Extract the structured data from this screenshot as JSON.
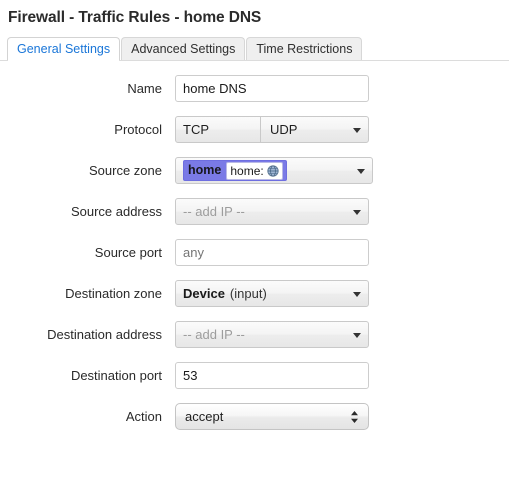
{
  "page": {
    "title": "Firewall - Traffic Rules - home DNS"
  },
  "tabs": [
    {
      "label": "General Settings",
      "active": true
    },
    {
      "label": "Advanced Settings",
      "active": false
    },
    {
      "label": "Time Restrictions",
      "active": false
    }
  ],
  "form": {
    "name": {
      "label": "Name",
      "value": "home DNS"
    },
    "protocol": {
      "label": "Protocol",
      "first": "TCP",
      "second": "UDP"
    },
    "source_zone": {
      "label": "Source zone",
      "token_key": "home",
      "token_chip_label": "home:",
      "token_chip_icon": "globe-icon"
    },
    "source_address": {
      "label": "Source address",
      "value": "-- add IP --"
    },
    "source_port": {
      "label": "Source port",
      "placeholder": "any",
      "value": ""
    },
    "destination_zone": {
      "label": "Destination zone",
      "value_strong": "Device",
      "value_soft": "(input)"
    },
    "destination_address": {
      "label": "Destination address",
      "value": "-- add IP --"
    },
    "destination_port": {
      "label": "Destination port",
      "value": "53"
    },
    "action": {
      "label": "Action",
      "value": "accept"
    }
  },
  "colors": {
    "accent_tab": "#1a76d8",
    "token_background": "#7a7ae6",
    "placeholder_text": "#9a9a9a"
  }
}
